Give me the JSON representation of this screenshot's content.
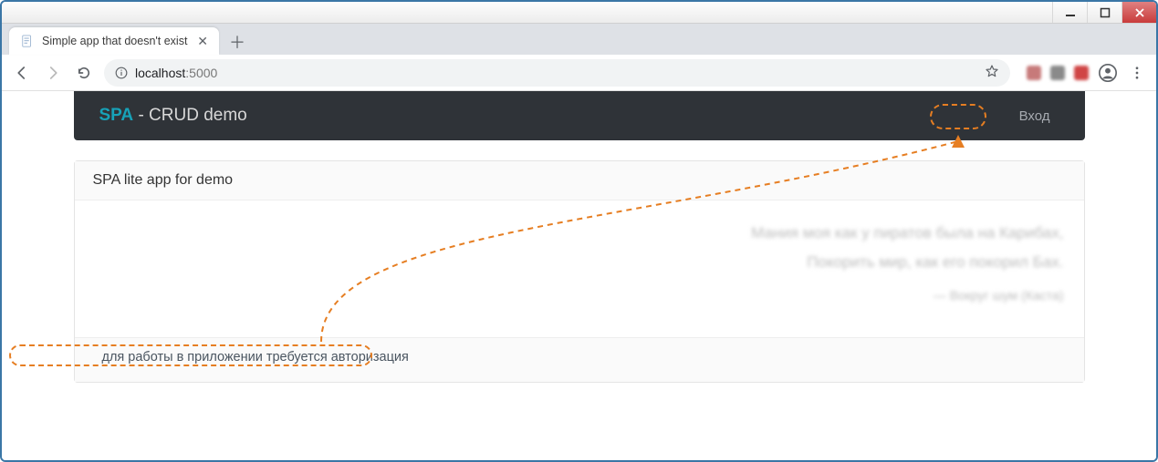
{
  "window": {
    "min_label": "Minimize",
    "max_label": "Maximize",
    "close_label": "Close"
  },
  "browser": {
    "tab_title": "Simple app that doesn't exist",
    "url_host": "localhost",
    "url_port": ":5000",
    "new_tab_tooltip": "New tab"
  },
  "page": {
    "brand_accent": "SPA",
    "brand_rest": " - CRUD demo",
    "login_label": "Вход",
    "card_title": "SPA lite app for demo",
    "blurred_line1": "Мания моя как у пиратов была на Карибах,",
    "blurred_line2": "Покорить мир, как его покорил Бах.",
    "blurred_attrib": "— Вокруг шум (Каста)",
    "auth_required_note": "для работы в приложении требуется авторизация"
  },
  "colors": {
    "annotation": "#e67e22",
    "navbar_bg": "#2f3338",
    "brand_accent": "#17a2b8"
  }
}
